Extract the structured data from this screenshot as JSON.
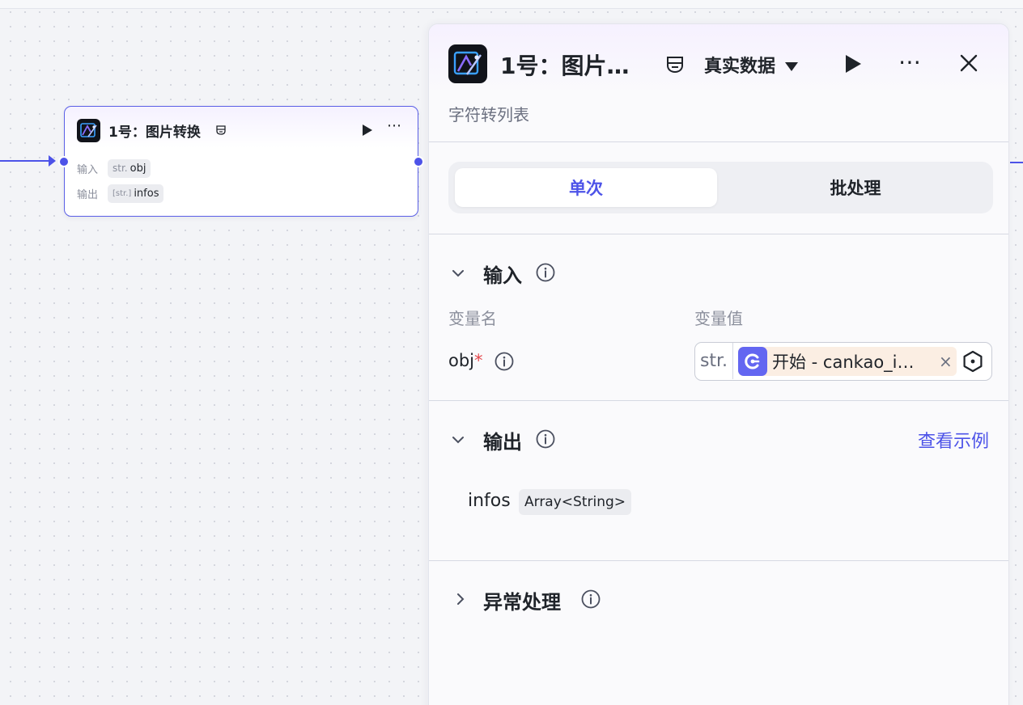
{
  "canvas_node": {
    "title": "1号：图片转换",
    "inputs": [
      {
        "label": "输入",
        "type": "str.",
        "name": "obj"
      }
    ],
    "outputs": [
      {
        "label": "输出",
        "type": "[str.]",
        "name": "infos"
      }
    ]
  },
  "panel": {
    "title": "1号：图片…",
    "data_source": "真实数据",
    "subtitle": "字符转列表",
    "tabs": [
      {
        "label": "单次",
        "active": true
      },
      {
        "label": "批处理",
        "active": false
      }
    ],
    "input_section": {
      "title": "输入",
      "col_name": "变量名",
      "col_value": "变量值",
      "variable": {
        "name": "obj",
        "required_mark": "*",
        "type": "str.",
        "ref_text": "开始 - cankao_i…",
        "remove_glyph": "×"
      }
    },
    "output_section": {
      "title": "输出",
      "example_link": "查看示例",
      "field": {
        "name": "infos",
        "type": "Array<String>"
      }
    },
    "exception_section": {
      "title": "异常处理"
    }
  },
  "colors": {
    "accent": "#4d53e8",
    "text": "#1f2329",
    "muted": "#8b8f9c",
    "required": "#e5484d",
    "ref_chip_bg": "#fbeee3"
  }
}
